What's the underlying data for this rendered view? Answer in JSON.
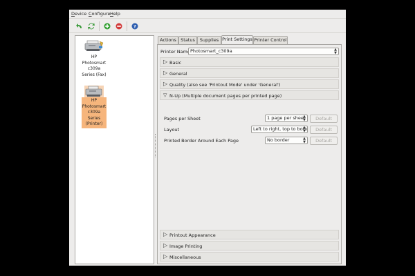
{
  "menu": {
    "device": "Device",
    "configure": "Configure",
    "help": "Help"
  },
  "toolbar": {
    "buttons": [
      {
        "icon": "back-arrow-icon",
        "color": "#3a9a3a"
      },
      {
        "icon": "refresh-icon",
        "color": "#3a9a3a"
      },
      {
        "icon": "add-icon",
        "color": "#2e9e2e"
      },
      {
        "icon": "remove-icon",
        "color": "#d23a3a"
      },
      {
        "icon": "help-icon",
        "color": "#2f5fb0"
      }
    ]
  },
  "printers": [
    {
      "label_lines": [
        "HP",
        "Photosmart",
        "c309a",
        "Series (Fax)"
      ],
      "selected": false
    },
    {
      "label_lines": [
        "HP",
        "Photosmart",
        "c309a",
        "Series",
        "(Printer)"
      ],
      "selected": true
    }
  ],
  "tabs": [
    "Actions",
    "Status",
    "Supplies",
    "Print Settings",
    "Printer Control"
  ],
  "active_tab": "Print Settings",
  "printer_name": {
    "label": "Printer Name:",
    "value": "Photosmart_c309a"
  },
  "sections_top": [
    {
      "label": "Basic",
      "expanded": false
    },
    {
      "label": "General",
      "expanded": false
    },
    {
      "label": "Quality (also see 'Printout Mode' under 'General')",
      "expanded": false
    },
    {
      "label": "N-Up (Multiple document pages per printed page)",
      "expanded": true
    }
  ],
  "nup_options": [
    {
      "label": "Pages per Sheet",
      "value": "1 page per sheet",
      "button": "Default"
    },
    {
      "label": "Layout",
      "value": "Left to right, top to bottom",
      "button": "Default"
    },
    {
      "label": "Printed Border Around Each Page",
      "value": "No border",
      "button": "Default"
    }
  ],
  "sections_bottom": [
    {
      "label": "Printout Appearance",
      "expanded": false
    },
    {
      "label": "Image Printing",
      "expanded": false
    },
    {
      "label": "Miscellaneous",
      "expanded": false
    }
  ]
}
